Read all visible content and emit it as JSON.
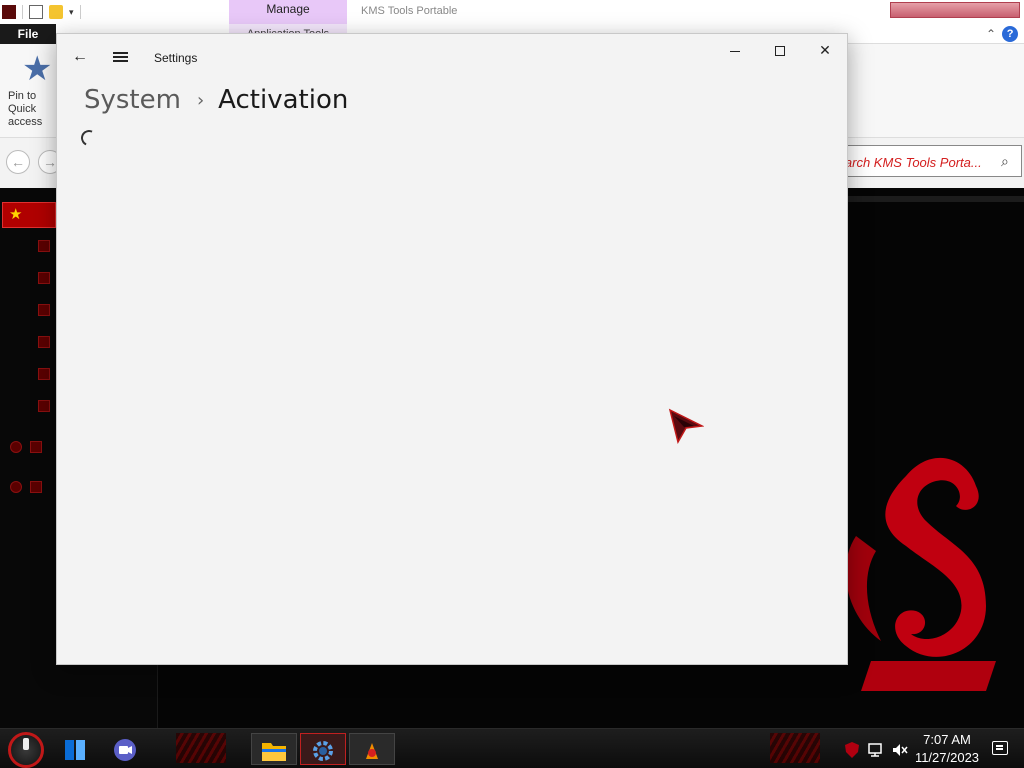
{
  "explorer": {
    "title": "KMS Tools Portable",
    "manage_tab": "Manage",
    "app_tools_tab": "Application Tools",
    "file_tab": "File",
    "pin_label": "Pin to Quick access",
    "search_placeholder": "Search KMS Tools Porta...",
    "quick_access_label": "Quick access",
    "help_label": "?",
    "icons": [
      "back-arrow-icon",
      "forward-arrow-icon",
      "star-icon",
      "search-icon"
    ]
  },
  "settings": {
    "window_title": "Settings",
    "breadcrumb": {
      "parent": "System",
      "separator": "›",
      "current": "Activation"
    },
    "loading": true
  },
  "taskbar": {
    "clock_time": "7:07 AM",
    "clock_date": "11/27/2023",
    "pinned": [
      "start-button",
      "task-view",
      "teams-chat",
      "file-explorer",
      "settings",
      "kms-tool"
    ]
  },
  "colors": {
    "accent": "#c01818",
    "settings_bg": "#f3f3f3",
    "search_text": "#d42020",
    "manage_tab": "#e8c8f8"
  }
}
